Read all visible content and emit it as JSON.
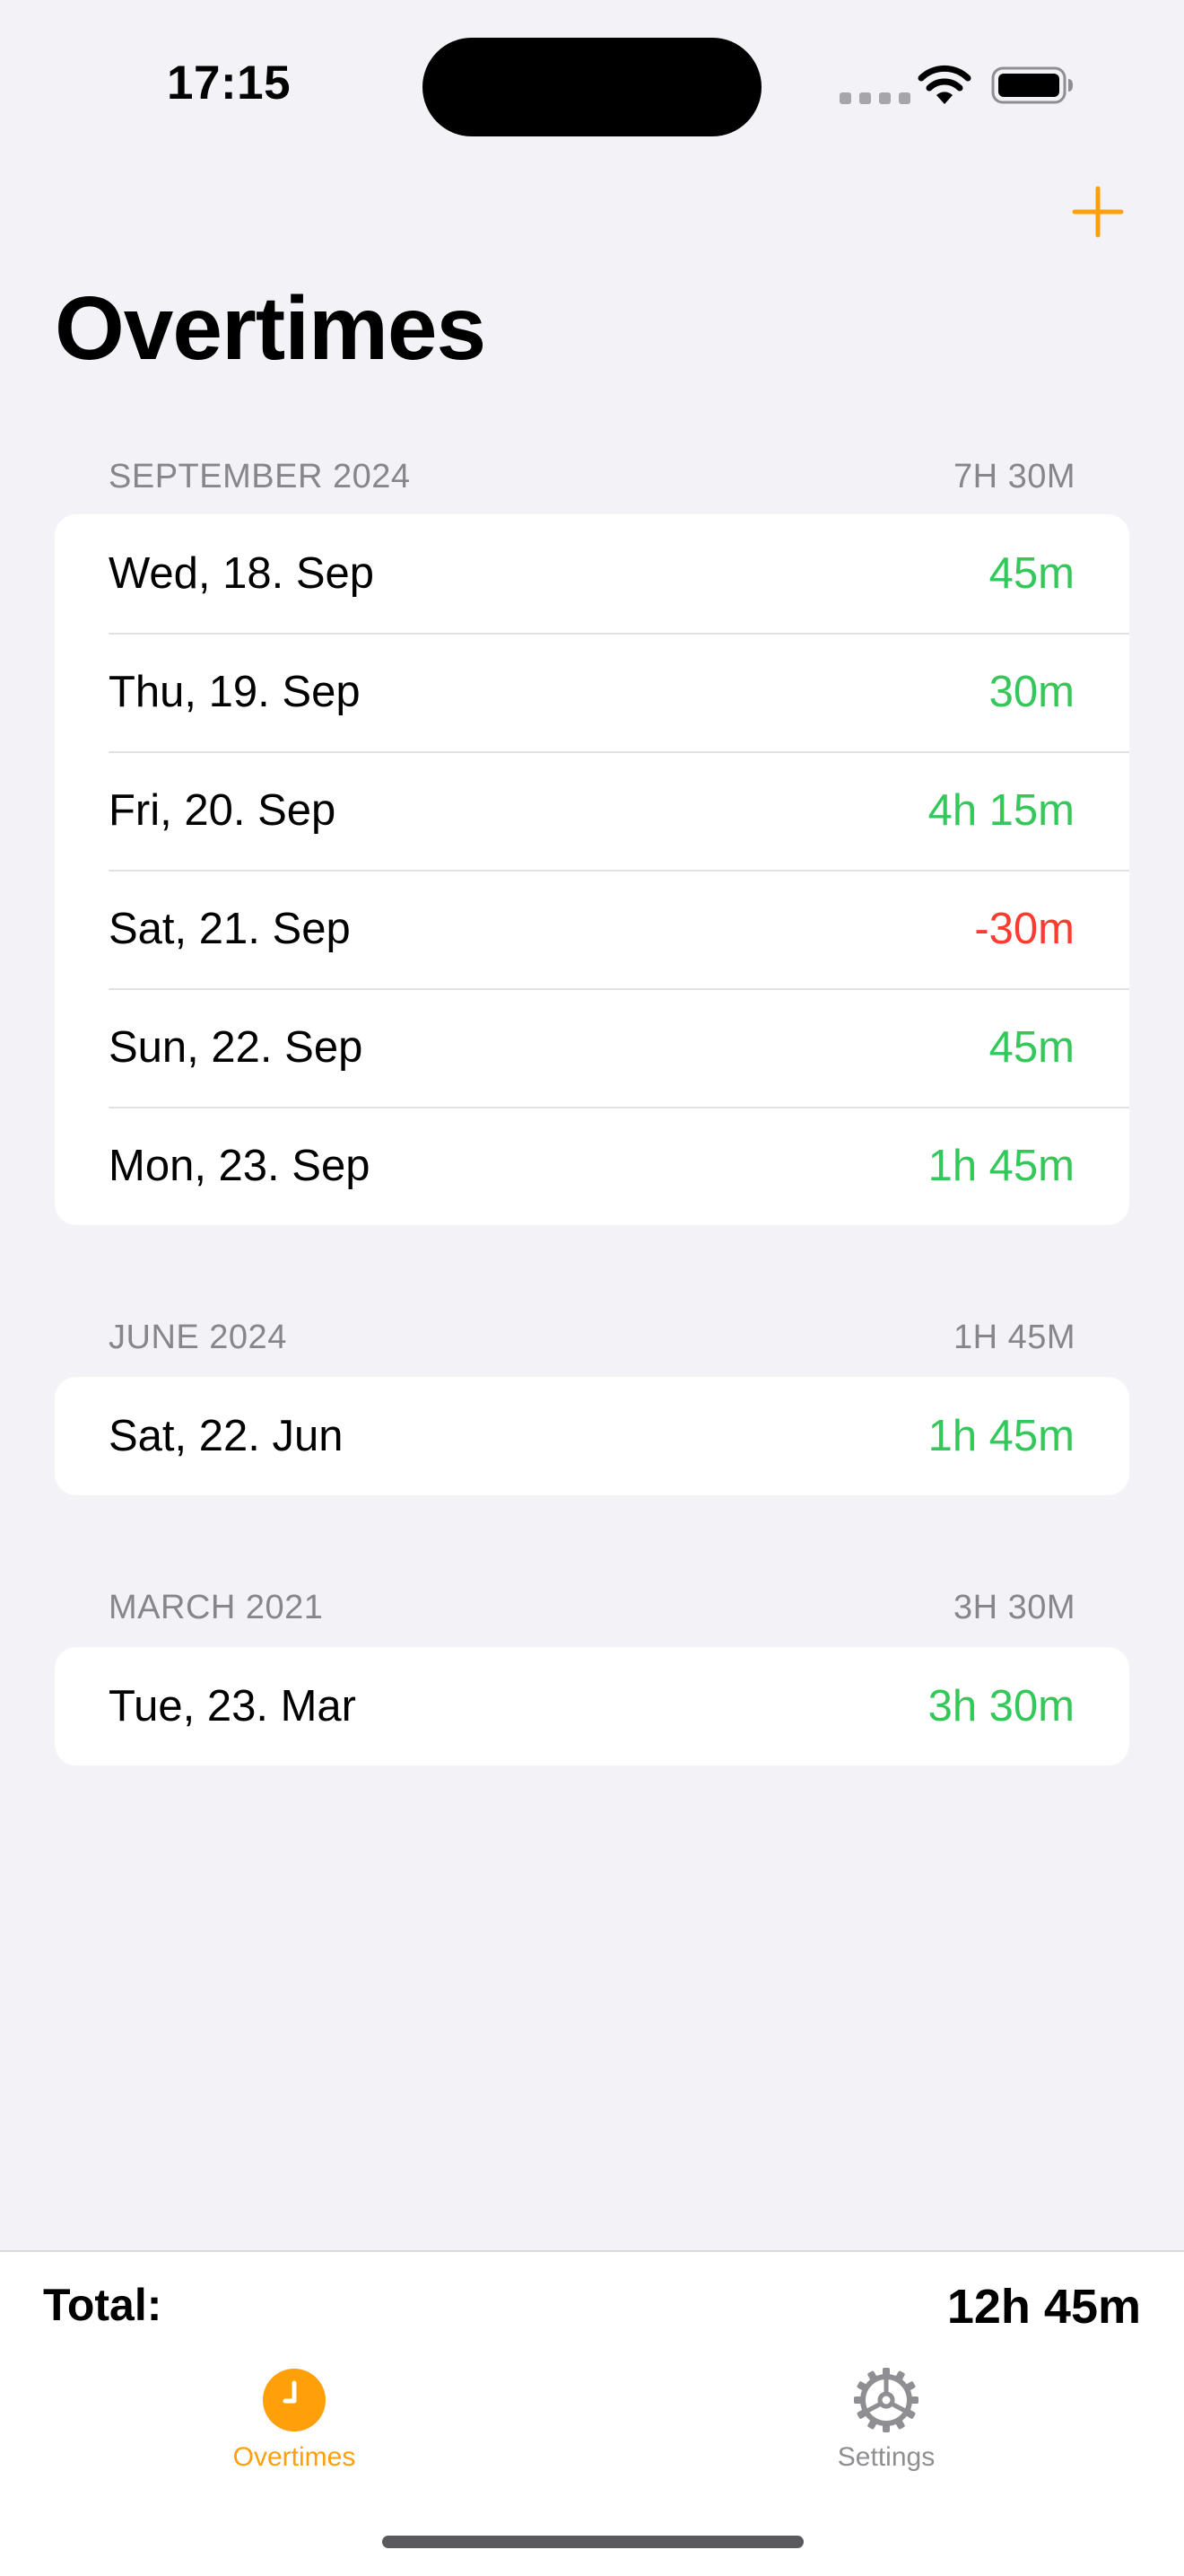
{
  "status_bar": {
    "time": "17:15"
  },
  "nav": {
    "title": "Overtimes",
    "add_icon": "plus-icon"
  },
  "sections": [
    {
      "header": "SEPTEMBER 2024",
      "total": "7H 30M",
      "rows": [
        {
          "date": "Wed, 18. Sep",
          "value": "45m",
          "status": "positive"
        },
        {
          "date": "Thu, 19. Sep",
          "value": "30m",
          "status": "positive"
        },
        {
          "date": "Fri, 20. Sep",
          "value": "4h 15m",
          "status": "positive"
        },
        {
          "date": "Sat, 21. Sep",
          "value": "-30m",
          "status": "negative"
        },
        {
          "date": "Sun, 22. Sep",
          "value": "45m",
          "status": "positive"
        },
        {
          "date": "Mon, 23. Sep",
          "value": "1h 45m",
          "status": "positive"
        }
      ]
    },
    {
      "header": "JUNE 2024",
      "total": "1H 45M",
      "rows": [
        {
          "date": "Sat, 22. Jun",
          "value": "1h 45m",
          "status": "positive"
        }
      ]
    },
    {
      "header": "MARCH 2021",
      "total": "3H 30M",
      "rows": [
        {
          "date": "Tue, 23. Mar",
          "value": "3h 30m",
          "status": "positive"
        }
      ]
    }
  ],
  "footer": {
    "total_label": "Total:",
    "total_value": "12h 45m"
  },
  "tabs": [
    {
      "label": "Overtimes",
      "icon": "clock-icon",
      "selected": true
    },
    {
      "label": "Settings",
      "icon": "gear-icon",
      "selected": false
    }
  ],
  "colors": {
    "accent": "#ff9f0a",
    "positive": "#34c759",
    "negative": "#ff3b30",
    "background": "#f2f2f7"
  }
}
